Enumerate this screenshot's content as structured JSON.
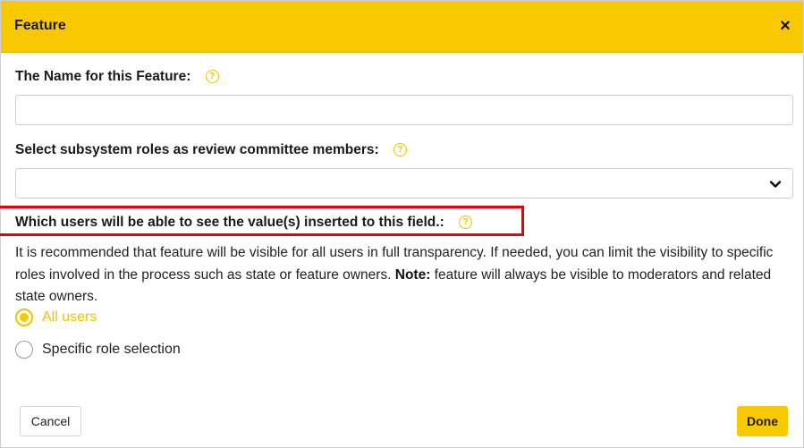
{
  "dialog": {
    "title": "Feature",
    "close_glyph": "×"
  },
  "fields": {
    "name": {
      "label": "The Name for this Feature:",
      "value": "",
      "placeholder": ""
    },
    "roles": {
      "label": "Select subsystem roles as review committee members:",
      "selected": ""
    },
    "visibility": {
      "label": "Which users will be able to see the value(s) inserted to this field.:",
      "desc_main": "It is recommended that feature will be visible for all users in full transparency. If needed, you can limit the visibility to specific roles involved in the process such as state or feature owners. ",
      "desc_note_label": "Note:",
      "desc_note": " feature will always be visible to moderators and related state owners.",
      "options": [
        {
          "label": "All users",
          "checked": true
        },
        {
          "label": "Specific role selection",
          "checked": false
        }
      ]
    }
  },
  "help_icon_glyph": "?",
  "buttons": {
    "cancel": "Cancel",
    "done": "Done"
  },
  "colors": {
    "accent": "#f8c900",
    "highlight": "#e8000b"
  },
  "icons": {
    "help": "help-circle-icon",
    "dropdown": "chevron-down-icon",
    "close": "close-icon"
  }
}
